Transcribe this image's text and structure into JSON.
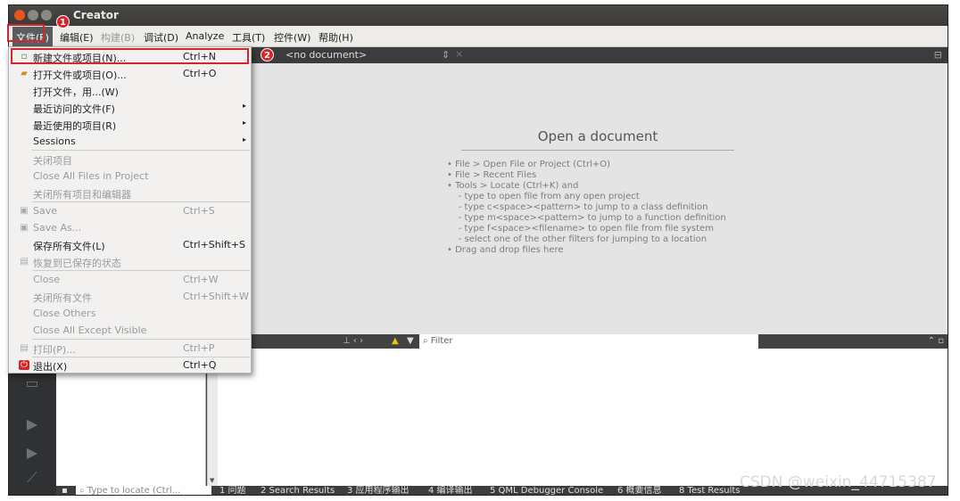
{
  "window": {
    "title": "Creator"
  },
  "menubar": {
    "file": "文件(F)",
    "edit": "编辑(E)",
    "build": "构建(B)",
    "debug": "调试(D)",
    "analyze": "Analyze",
    "tools": "工具(T)",
    "controls": "控件(W)",
    "help": "帮助(H)"
  },
  "file_menu": {
    "new": {
      "label": "新建文件或项目(N)...",
      "shortcut": "Ctrl+N"
    },
    "open": {
      "label": "打开文件或项目(O)...",
      "shortcut": "Ctrl+O"
    },
    "open_with": {
      "label": "打开文件，用...(W)"
    },
    "recent_files": {
      "label": "最近访问的文件(F)"
    },
    "recent_projects": {
      "label": "最近使用的项目(R)"
    },
    "sessions": {
      "label": "Sessions"
    },
    "close_project": {
      "label": "关闭项目"
    },
    "close_all_in_project": {
      "label": "Close All Files in Project"
    },
    "close_all_projects": {
      "label": "关闭所有项目和编辑器"
    },
    "save": {
      "label": "Save",
      "shortcut": "Ctrl+S"
    },
    "save_as": {
      "label": "Save As..."
    },
    "save_all": {
      "label": "保存所有文件(L)",
      "shortcut": "Ctrl+Shift+S"
    },
    "revert": {
      "label": "恢复到已保存的状态"
    },
    "close": {
      "label": "Close",
      "shortcut": "Ctrl+W"
    },
    "close_all": {
      "label": "关闭所有文件",
      "shortcut": "Ctrl+Shift+W"
    },
    "close_others": {
      "label": "Close Others"
    },
    "close_all_except_visible": {
      "label": "Close All Except Visible"
    },
    "print": {
      "label": "打印(P)...",
      "shortcut": "Ctrl+P"
    },
    "exit": {
      "label": "退出(X)",
      "shortcut": "Ctrl+Q"
    }
  },
  "editor": {
    "document_selector": "<no document>",
    "heading": "Open a document",
    "hints": "• File > Open File or Project (Ctrl+O)\n• File > Recent Files\n• Tools > Locate (Ctrl+K) and\n    - type to open file from any open project\n    - type c<space><pattern> to jump to a class definition\n    - type m<space><pattern> to jump to a function definition\n    - type f<space><filename> to open file from file system\n    - select one of the other filters for jumping to a location\n• Drag and drop files here"
  },
  "output_pane": {
    "filter_placeholder": "Filter"
  },
  "statusbar": {
    "locate_placeholder": "Type to locate (Ctrl...",
    "tabs": [
      "1 问题",
      "2 Search Results",
      "3 应用程序输出",
      "4 编译输出",
      "5 QML Debugger Console",
      "6 概要信息",
      "8 Test Results"
    ]
  },
  "annotations": {
    "step1": "1",
    "step2": "2"
  },
  "watermark": "CSDN @weixin_44715387",
  "colors": {
    "highlight": "#d7262b",
    "accent": "#e95420"
  },
  "icons": [
    "new-file-icon",
    "open-folder-icon",
    "save-icon",
    "save-as-icon",
    "revert-icon",
    "print-icon",
    "exit-icon",
    "warning-icon",
    "filter-icon",
    "search-icon"
  ]
}
